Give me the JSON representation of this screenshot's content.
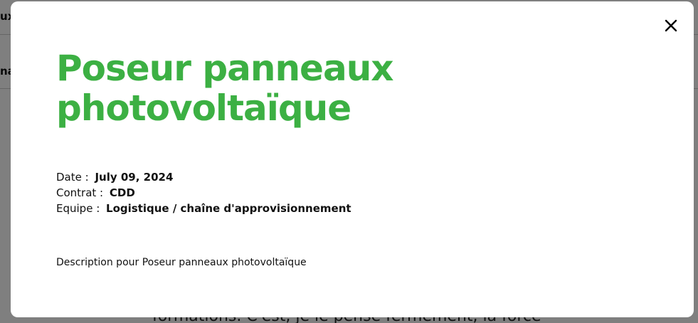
{
  "background": {
    "header_text": "ux",
    "nav_text": "na",
    "body_text": "formations. C'est, je le pense fermement, la force"
  },
  "modal": {
    "close_icon": "close-icon",
    "title": "Poseur panneaux photovoltaïque",
    "title_color": "#3cb043",
    "fields": {
      "date": {
        "label": "Date :",
        "value": "July 09, 2024"
      },
      "contract": {
        "label": "Contrat :",
        "value": "CDD"
      },
      "team": {
        "label": "Equipe :",
        "value": "Logistique / chaîne d'approvisionnement"
      }
    },
    "description": "Description pour Poseur panneaux photovoltaïque"
  }
}
